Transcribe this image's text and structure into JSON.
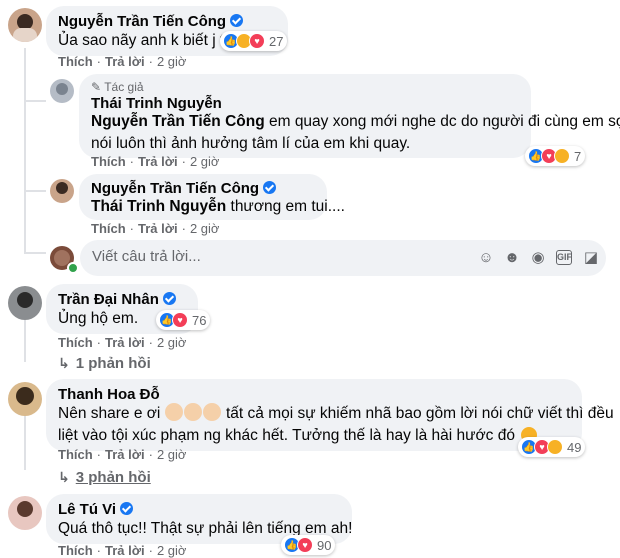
{
  "comments": [
    {
      "author": "Nguyễn Trần Tiến Công",
      "text": "Ủa sao nãy anh k biết j ta",
      "reaction_count": "27",
      "like_label": "Thích",
      "reply_label": "Trả lời",
      "time": "2 giờ"
    },
    {
      "author_badge": "Tác giả",
      "author": "Thái Trinh Nguyễn",
      "mention": "Nguyễn Trần Tiến Công",
      "text_line1": " em quay xong mới nghe dc do người đi cùng em sợ",
      "text_line2": "nói luôn thì ảnh hưởng tâm lí của em khi quay.",
      "reaction_count": "7",
      "like_label": "Thích",
      "reply_label": "Trả lời",
      "time": "2 giờ"
    },
    {
      "author": "Nguyễn Trần Tiến Công",
      "mention": "Thái Trinh Nguyễn",
      "text": " thương em tui....",
      "like_label": "Thích",
      "reply_label": "Trả lời",
      "time": "2 giờ"
    },
    {
      "author": "Trần Đại Nhân",
      "text": "Ủng hộ em.",
      "reaction_count": "76",
      "like_label": "Thích",
      "reply_label": "Trả lời",
      "time": "2 giờ",
      "replies_link": "1 phản hồi"
    },
    {
      "author": "Thanh Hoa Đỗ",
      "text_line1a": "Nên share e ơi ",
      "text_line1b": " tất cả mọi sự khiếm nhã bao gồm lời nói chữ viết thì đều",
      "text_line2": "liệt vào tội xúc phạm ng khác hết. Tưởng thế là hay là hài hước đó ",
      "reaction_count": "49",
      "like_label": "Thích",
      "reply_label": "Trả lời",
      "time": "2 giờ",
      "replies_link": "3 phản hồi"
    },
    {
      "author": "Lê Tú Vi",
      "text": "Quá thô tục!! Thật sự phải lên tiếng em ah!",
      "reaction_count": "90",
      "like_label": "Thích",
      "reply_label": "Trả lời",
      "time": "2 giờ"
    }
  ],
  "reply_input": {
    "placeholder": "Viết câu trả lời..."
  },
  "icons": [
    "like-icon",
    "love-icon",
    "haha-icon",
    "care-icon",
    "verified-icon",
    "emoji-icon",
    "camera-icon",
    "gif-icon",
    "sticker-icon",
    "reply-arrow-icon"
  ],
  "colors": {
    "bubble": "#f0f2f5",
    "verified": "#1877f2",
    "meta": "#65676b"
  }
}
